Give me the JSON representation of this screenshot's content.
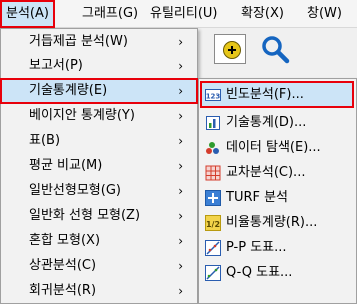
{
  "menubar": {
    "items": [
      {
        "label": "분석(A)"
      },
      {
        "label": "그래프(G)"
      },
      {
        "label": "유틸리티(U)"
      },
      {
        "label": "확장(X)"
      },
      {
        "label": "창(W)"
      }
    ]
  },
  "analyze_menu": {
    "items": [
      {
        "label": "거듭제곱 분석(W)",
        "has_submenu": true
      },
      {
        "label": "보고서(P)",
        "has_submenu": true
      },
      {
        "label": "기술통계량(E)",
        "has_submenu": true,
        "selected": true
      },
      {
        "label": "베이지안 통계량(Y)",
        "has_submenu": true
      },
      {
        "label": "표(B)",
        "has_submenu": true
      },
      {
        "label": "평균 비교(M)",
        "has_submenu": true
      },
      {
        "label": "일반선형모형(G)",
        "has_submenu": true
      },
      {
        "label": "일반화 선형 모형(Z)",
        "has_submenu": true
      },
      {
        "label": "혼합 모형(X)",
        "has_submenu": true
      },
      {
        "label": "상관분석(C)",
        "has_submenu": true
      },
      {
        "label": "회귀분석(R)",
        "has_submenu": true
      }
    ],
    "arrow_glyph": "›"
  },
  "descriptives_submenu": {
    "items": [
      {
        "label": "빈도분석(F)...",
        "icon": "frequencies-icon",
        "selected": true
      },
      {
        "label": "기술통계(D)...",
        "icon": "descriptives-icon"
      },
      {
        "label": "데이터 탐색(E)...",
        "icon": "explore-icon"
      },
      {
        "label": "교차분석(C)...",
        "icon": "crosstabs-icon"
      },
      {
        "label": "TURF 분석",
        "icon": "turf-icon"
      },
      {
        "label": "비율통계량(R)...",
        "icon": "ratio-icon"
      },
      {
        "label": "P-P 도표...",
        "icon": "pp-plot-icon"
      },
      {
        "label": "Q-Q 도표...",
        "icon": "qq-plot-icon"
      }
    ]
  },
  "colors": {
    "highlight": "#cce4f7",
    "annotation_border": "#e8000b",
    "magnifier": "#1565c0"
  }
}
